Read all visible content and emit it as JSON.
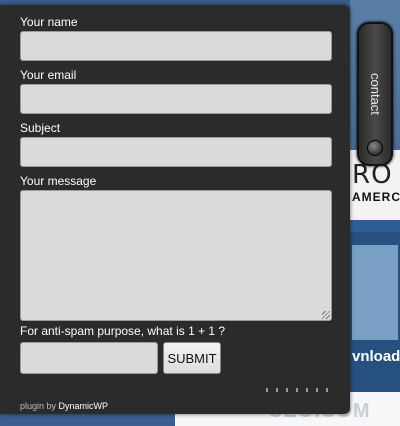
{
  "form": {
    "name_label": "Your name",
    "email_label": "Your email",
    "subject_label": "Subject",
    "message_label": "Your message",
    "antispam_label": "For anti-spam purpose, what is 1 + 1 ?",
    "submit_label": "SUBMIT",
    "name_value": "",
    "email_value": "",
    "subject_value": "",
    "message_value": "",
    "antispam_value": ""
  },
  "tab": {
    "label": "contact"
  },
  "credit": {
    "prefix": "plugin by ",
    "link": "DynamicWP"
  },
  "background": {
    "brand": "RO",
    "brand_sub": "AMERCE",
    "download_text": "vnload",
    "watermark": "CEO.COM"
  },
  "colors": {
    "panel": "#2b2b2b",
    "field": "#dadada",
    "page_bg": "#3a5f8f"
  }
}
